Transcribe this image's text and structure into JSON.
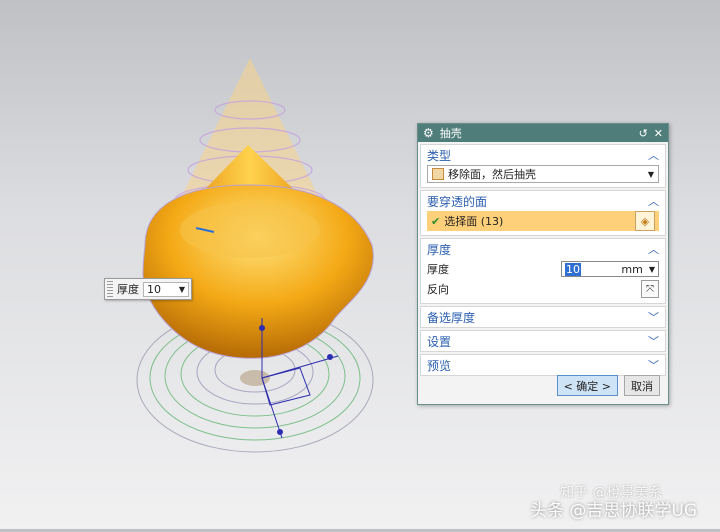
{
  "floating_input": {
    "label": "厚度",
    "value": "10"
  },
  "dialog": {
    "title": "抽壳",
    "sections": {
      "type": {
        "header": "类型",
        "selected": "移除面，然后抽壳"
      },
      "faces": {
        "header": "要穿透的面",
        "selection": "选择面 (13)"
      },
      "thickness": {
        "header": "厚度",
        "label": "厚度",
        "value": "10",
        "unit": "mm",
        "reverse_label": "反向"
      },
      "alt_thickness": {
        "header": "备选厚度"
      },
      "settings": {
        "header": "设置"
      },
      "preview": {
        "header": "预览"
      }
    },
    "buttons": {
      "ok": "< 确定 >",
      "cancel": "取消"
    }
  },
  "watermark": {
    "line1": "知乎 @橙景美系",
    "line2": "头条 @吉思协联学UG"
  },
  "colors": {
    "title_bar": "#4f7d7a",
    "section_header": "#2b5fb0",
    "selection_highlight": "#ffd07a",
    "model": "#f3a21a"
  }
}
